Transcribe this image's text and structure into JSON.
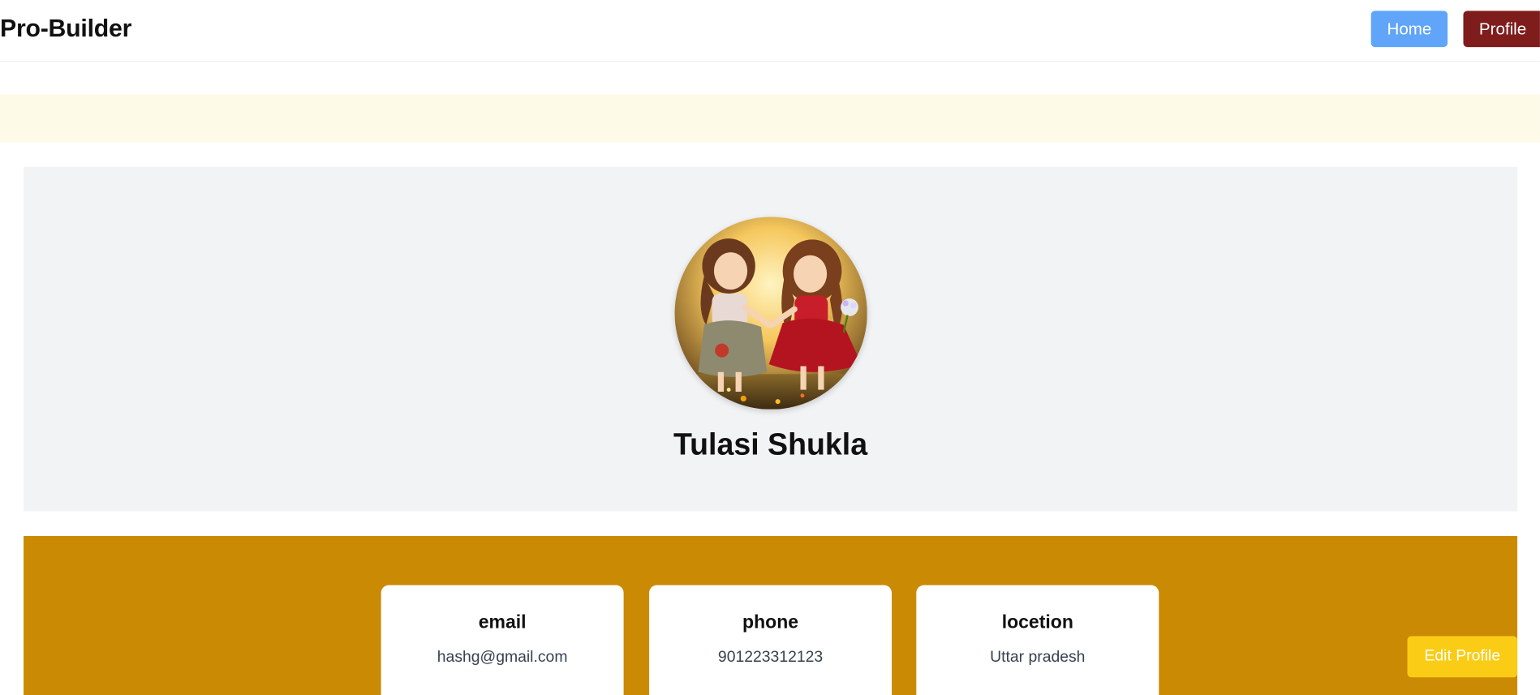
{
  "header": {
    "brand": "Pro-Builder",
    "nav": {
      "home_label": "Home",
      "profile_label": "Profile"
    }
  },
  "profile": {
    "name": "Tulasi Shukla",
    "avatar_alt": "profile-avatar"
  },
  "info": [
    {
      "title": "email",
      "value": "hashg@gmail.com"
    },
    {
      "title": "phone",
      "value": "901223312123"
    },
    {
      "title": "locetion",
      "value": "Uttar pradesh"
    }
  ],
  "actions": {
    "edit_label": "Edit Profile"
  },
  "colors": {
    "home_button": "#60a5fa",
    "profile_button": "#7f1d1d",
    "banner": "#fefae8",
    "profile_card": "#f2f3f5",
    "info_section": "#ca8a04",
    "edit_button": "#facc15"
  }
}
